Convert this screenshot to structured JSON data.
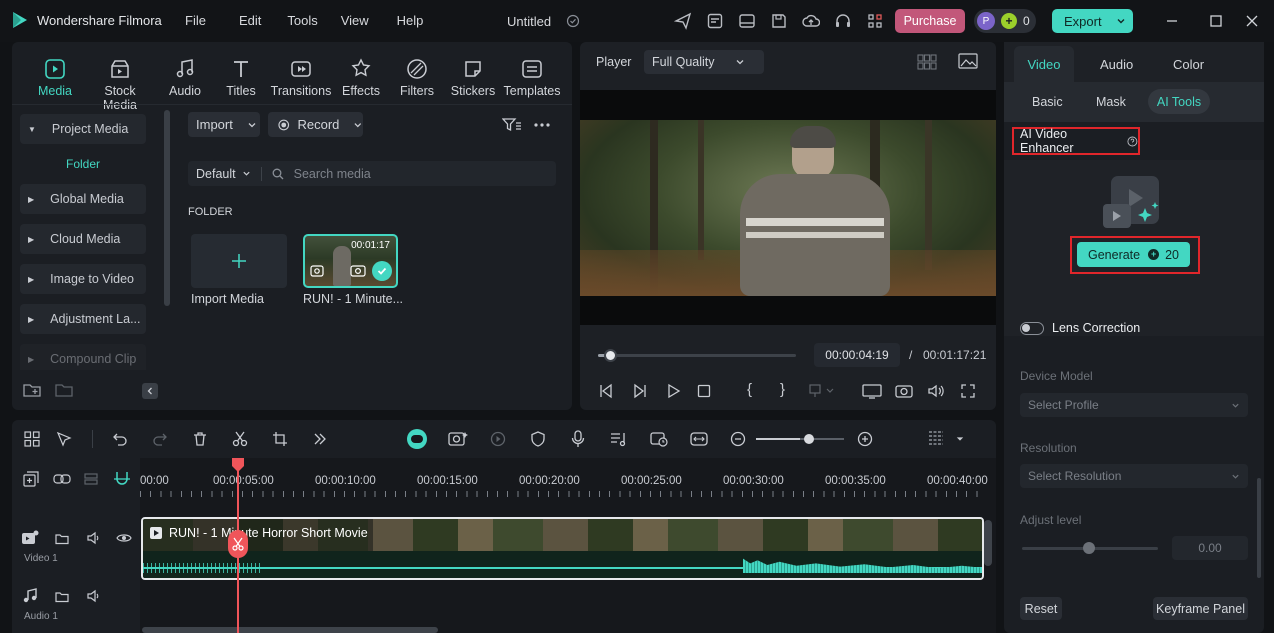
{
  "app": {
    "name": "Wondershare Filmora",
    "project_title": "Untitled",
    "menu": [
      "File",
      "Edit",
      "Tools",
      "View",
      "Help"
    ],
    "purchase_label": "Purchase",
    "credits_count": "0",
    "avatar_letter": "P",
    "export_label": "Export"
  },
  "media_tabs": [
    {
      "label": "Media",
      "icon": "media-icon",
      "active": true
    },
    {
      "label": "Stock Media",
      "icon": "stock-media-icon"
    },
    {
      "label": "Audio",
      "icon": "audio-icon"
    },
    {
      "label": "Titles",
      "icon": "titles-icon"
    },
    {
      "label": "Transitions",
      "icon": "transitions-icon"
    },
    {
      "label": "Effects",
      "icon": "effects-icon"
    },
    {
      "label": "Filters",
      "icon": "filters-icon"
    },
    {
      "label": "Stickers",
      "icon": "stickers-icon"
    },
    {
      "label": "Templates",
      "icon": "templates-icon"
    }
  ],
  "sidebar": {
    "project_media": "Project Media",
    "folder": "Folder",
    "items": [
      "Global Media",
      "Cloud Media",
      "Image to Video",
      "Adjustment La...",
      "Compound Clip"
    ]
  },
  "library": {
    "import_label": "Import",
    "record_label": "Record",
    "sort_label": "Default",
    "search_placeholder": "Search media",
    "folder_heading": "FOLDER",
    "import_media_label": "Import Media",
    "clip_name": "RUN! - 1 Minute...",
    "clip_duration": "00:01:17"
  },
  "player": {
    "label": "Player",
    "quality": "Full Quality",
    "current_time": "00:00:04:19",
    "separator": "/",
    "total_time": "00:01:17:21",
    "progress": 0.06
  },
  "timeline": {
    "ruler": [
      "00:00",
      "00:00:05:00",
      "00:00:10:00",
      "00:00:15:00",
      "00:00:20:00",
      "00:00:25:00",
      "00:00:30:00",
      "00:00:35:00",
      "00:00:40:00"
    ],
    "clip_title": "RUN! - 1 Minute Horror Short Movie",
    "video_track": "Video 1",
    "audio_track": "Audio 1",
    "zoom": 0.5
  },
  "right_panel": {
    "tabs": [
      "Video",
      "Audio",
      "Color"
    ],
    "subtabs": [
      "Basic",
      "Mask",
      "AI Tools"
    ],
    "enhancer_title": "AI Video Enhancer",
    "generate_label": "Generate",
    "generate_cost": "20",
    "lens_correction": "Lens Correction",
    "device_model_label": "Device Model",
    "device_model_placeholder": "Select Profile",
    "resolution_label": "Resolution",
    "resolution_placeholder": "Select Resolution",
    "adjust_level_label": "Adjust level",
    "adjust_value": "0.00",
    "reset_label": "Reset",
    "keyframe_label": "Keyframe Panel"
  },
  "colors": {
    "accent": "#43d7c2",
    "purchase": "#c2577a",
    "highlight_box": "#e0262b",
    "playhead": "#f0555a"
  }
}
